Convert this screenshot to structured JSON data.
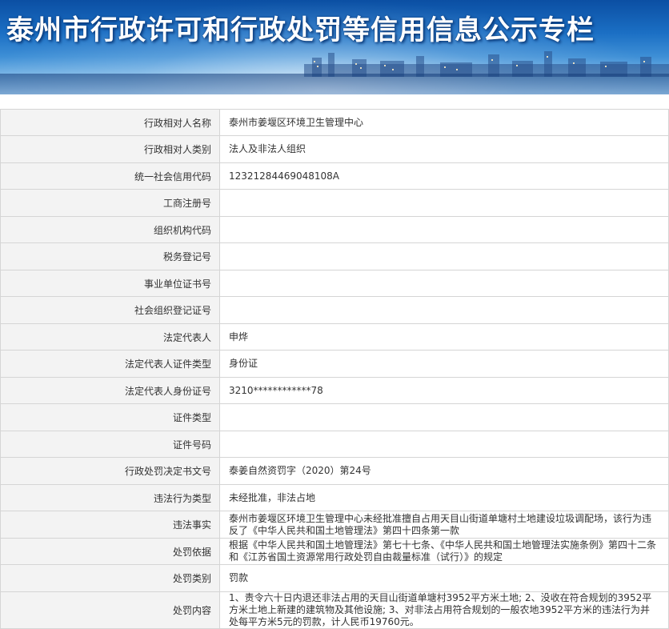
{
  "banner": {
    "title": "泰州市行政许可和行政处罚等信用信息公示专栏"
  },
  "rows": [
    {
      "label": "行政相对人名称",
      "value": "泰州市姜堰区环境卫生管理中心"
    },
    {
      "label": "行政相对人类别",
      "value": "法人及非法人组织"
    },
    {
      "label": "统一社会信用代码",
      "value": "12321284469048108A"
    },
    {
      "label": "工商注册号",
      "value": ""
    },
    {
      "label": "组织机构代码",
      "value": ""
    },
    {
      "label": "税务登记号",
      "value": ""
    },
    {
      "label": "事业单位证书号",
      "value": ""
    },
    {
      "label": "社会组织登记证号",
      "value": ""
    },
    {
      "label": "法定代表人",
      "value": "申烨"
    },
    {
      "label": "法定代表人证件类型",
      "value": "身份证"
    },
    {
      "label": "法定代表人身份证号",
      "value": "3210************78"
    },
    {
      "label": "证件类型",
      "value": ""
    },
    {
      "label": "证件号码",
      "value": ""
    },
    {
      "label": "行政处罚决定书文号",
      "value": "泰姜自然资罚字（2020）第24号"
    },
    {
      "label": "违法行为类型",
      "value": "未经批准，非法占地"
    },
    {
      "label": "违法事实",
      "value": "泰州市姜堰区环境卫生管理中心未经批准擅自占用天目山街道单塘村土地建设垃圾调配场，该行为违反了《中华人民共和国土地管理法》第四十四条第一款"
    },
    {
      "label": "处罚依据",
      "value": "根据《中华人民共和国土地管理法》第七十七条、《中华人民共和国土地管理法实施条例》第四十二条和《江苏省国土资源常用行政处罚自由裁量标准（试行）》的规定"
    },
    {
      "label": "处罚类别",
      "value": "罚款"
    },
    {
      "label": "处罚内容",
      "value": "1、责令六十日内退还非法占用的天目山街道单塘村3952平方米土地; 2、没收在符合规划的3952平方米土地上新建的建筑物及其他设施; 3、对非法占用符合规划的一般农地3952平方米的违法行为并处每平方米5元的罚款，计人民币19760元。"
    }
  ]
}
